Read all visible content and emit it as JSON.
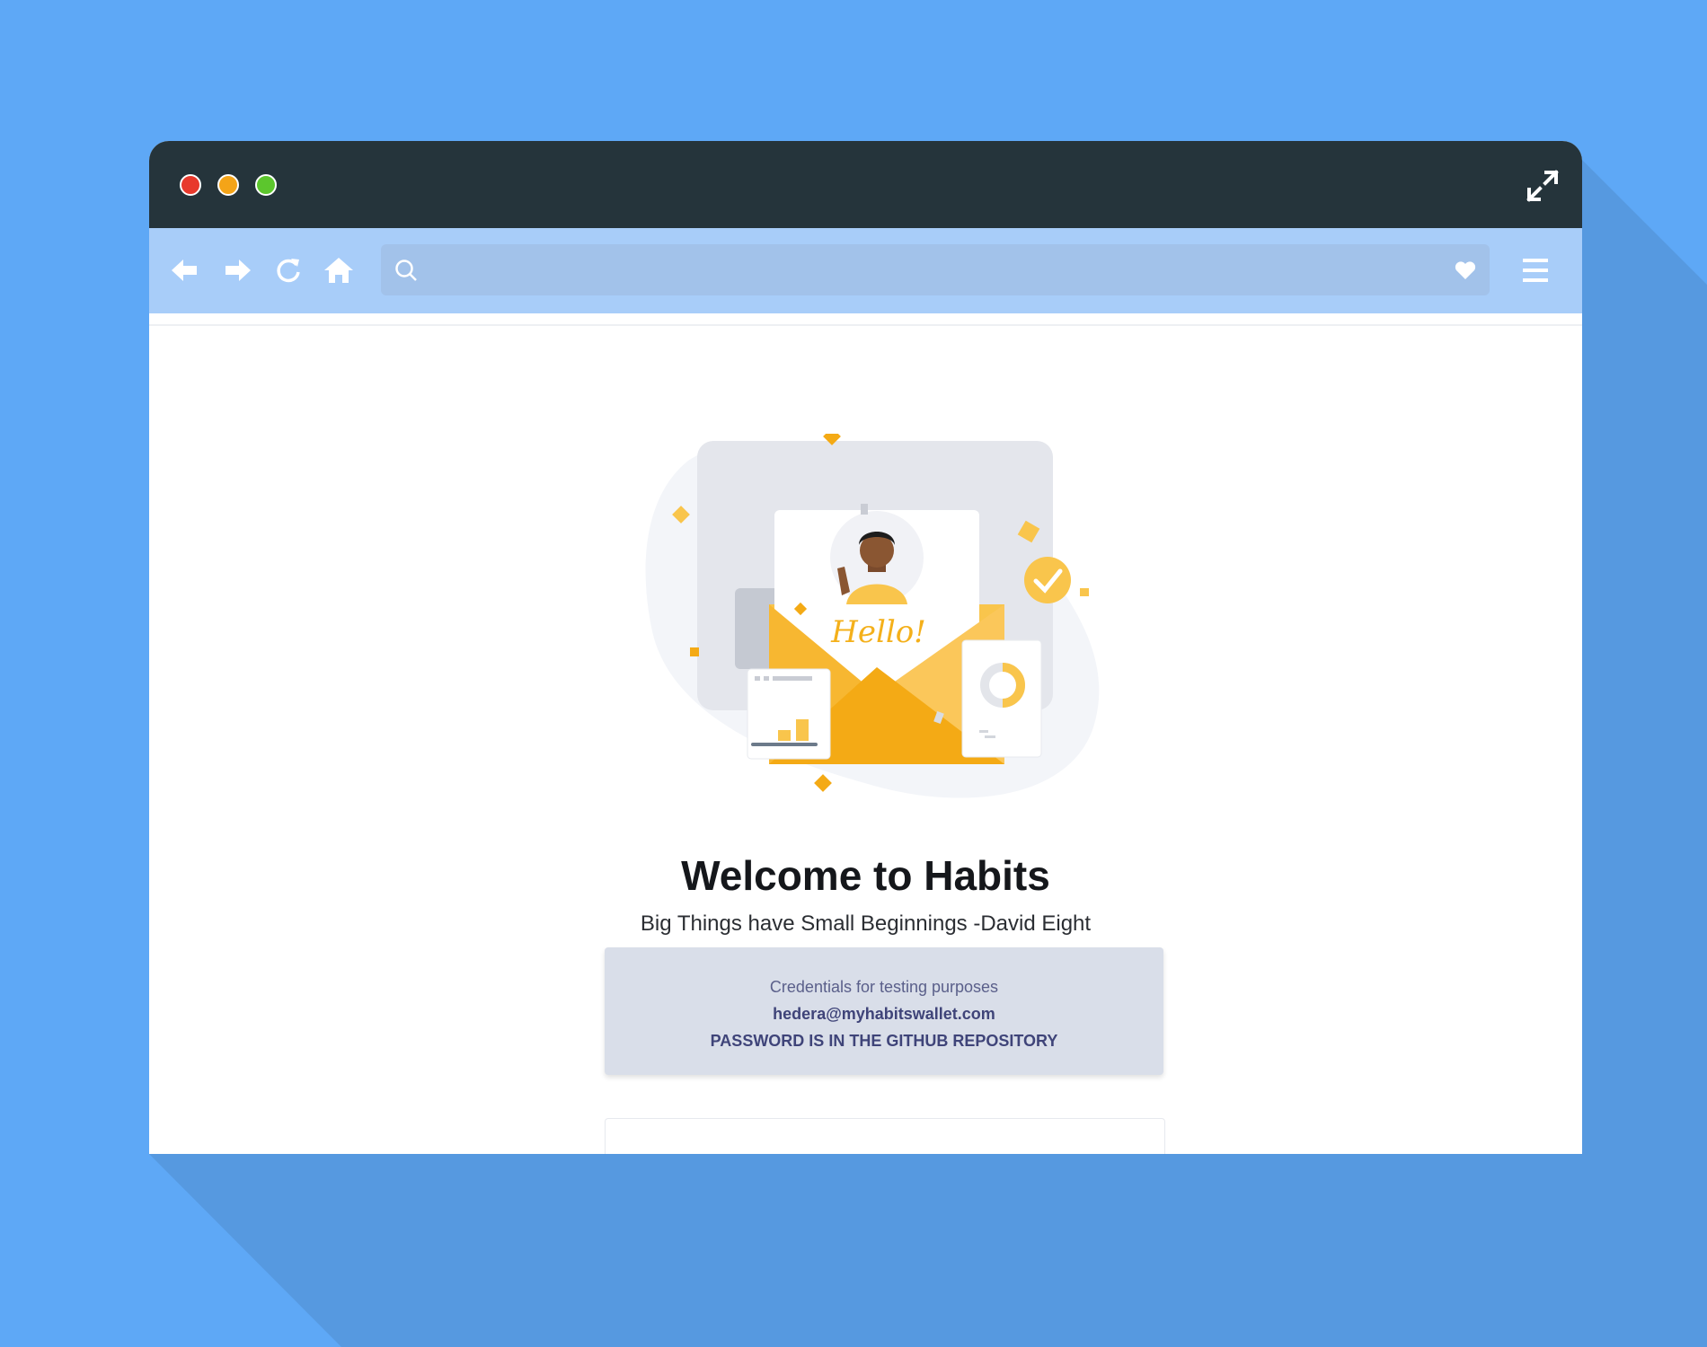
{
  "page": {
    "title": "Welcome to Habits",
    "subtitle": "Big Things have Small Beginnings -David Eight"
  },
  "browser": {
    "address_value": "",
    "icons": [
      "arrow-left-icon",
      "arrow-right-icon",
      "reload-icon",
      "home-icon",
      "search-icon",
      "heart-icon",
      "hamburger-menu-icon",
      "expand-icon"
    ]
  },
  "illustration": {
    "greeting": "Hello!"
  },
  "credentials": {
    "heading": "Credentials for testing purposes",
    "email": "hedera@myhabitswallet.com",
    "password_note": "PASSWORD IS IN THE GITHUB REPOSITORY"
  },
  "colors": {
    "background": "#5ea8f6",
    "titlebar": "#25343b",
    "toolbar": "#a8cdf9",
    "accent_yellow": "#f9b21b",
    "credential_box": "#d9dee9"
  }
}
